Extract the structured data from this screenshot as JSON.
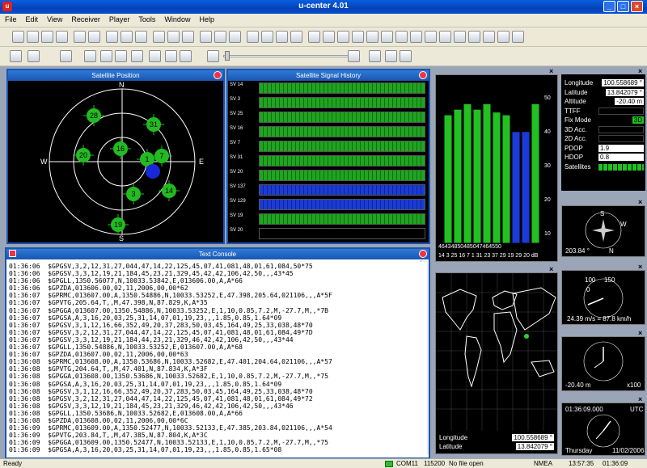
{
  "window": {
    "title": "u-center 4.01",
    "icon": "u",
    "min": "_",
    "max": "□",
    "close": "×"
  },
  "menu": [
    "File",
    "Edit",
    "View",
    "Receiver",
    "Player",
    "Tools",
    "Window",
    "Help"
  ],
  "panels": {
    "sat_position": "Satellite Position",
    "signal_history": "Satellite Signal History",
    "text_console": "Text Console"
  },
  "compass": {
    "n": "N",
    "s": "S",
    "e": "E",
    "w": "W"
  },
  "satellites": [
    "28",
    "31",
    "16",
    "1",
    "7",
    "20",
    "3",
    "14",
    "19"
  ],
  "signal_history_labels": [
    "SV 14",
    "SV 3",
    "SV 25",
    "SV 16",
    "SV 7",
    "SV 31",
    "SV 20",
    "SV 137",
    "SV 129",
    "SV 19",
    "SV 20"
  ],
  "bar_chart": {
    "values": [
      46,
      43,
      48,
      50,
      48,
      50,
      47,
      46,
      45,
      50
    ],
    "low_labels": [
      "14",
      "3",
      "25",
      "16",
      "7",
      "1",
      "31",
      "23",
      "37",
      "29",
      "19",
      "29",
      "20"
    ],
    "unit": "dB",
    "ticks": [
      "50",
      "40",
      "30",
      "20",
      "10"
    ]
  },
  "console_lines": [
    "01:36:06  $GPGSV,3,2,12,31,27,044,47,14,22,125,45,07,41,081,48,01,61,084,50*75",
    "01:36:06  $GPGSV,3,3,12,19,21,184,45,23,21,329,45,42,42,106,42,50,,,43*45",
    "01:36:06  $GPGLL,1350.56077,N,10033.53842,E,013606.00,A,A*66",
    "01:36:06  $GPZDA,013606.00,02,11,2006,00,00*62",
    "01:36:07  $GPRMC,013607.00,A,1350.54886,N,10033.53252,E,47.398,205.64,021106,,,A*5F",
    "01:36:07  $GPVTG,205.64,T,,M,47.398,N,87.829,K,A*35",
    "01:36:07  $GPGGA,013607.00,1350.54886,N,10033.53252,E,1,10,0.85,7.2,M,-27.7,M,,*7B",
    "01:36:07  $GPGSA,A,3,16,20,03,25,31,14,07,01,19,23,,,1.85,0.85,1.64*09",
    "01:36:07  $GPGSV,3,1,12,16,66,352,49,20,37,283,50,03,45,164,49,25,33,038,48*70",
    "01:36:07  $GPGSV,3,2,12,31,27,044,47,14,22,125,45,07,41,081,48,01,61,084,49*7D",
    "01:36:07  $GPGSV,3,3,12,19,21,184,44,23,21,329,46,42,42,106,42,50,,,43*44",
    "01:36:07  $GPGLL,1350.54886,N,10033.53252,E,013607.00,A,A*68",
    "01:36:07  $GPZDA,013607.00,02,11,2006,00,00*63",
    "01:36:08  $GPRMC,013608.00,A,1350.53686,N,10033.52682,E,47.401,204.64,021106,,,A*57",
    "01:36:08  $GPVTG,204.64,T,,M,47.401,N,87.834,K,A*3F",
    "01:36:08  $GPGGA,013608.00,1350.53686,N,10033.52682,E,1,10,0.85,7.2,M,-27.7,M,,*75",
    "01:36:08  $GPGSA,A,3,16,20,03,25,31,14,07,01,19,23,,,1.85,0.85,1.64*09",
    "01:36:08  $GPGSV,3,1,12,16,66,352,49,20,37,283,50,03,45,164,49,25,33,038,48*70",
    "01:36:08  $GPGSV,3,2,12,31,27,044,47,14,22,125,45,07,41,081,48,01,61,084,49*72",
    "01:36:08  $GPGSV,3,3,12,19,21,184,45,23,21,329,46,42,42,106,42,50,,,43*46",
    "01:36:08  $GPGLL,1350.53686,N,10033.52682,E,013608.00,A,A*66",
    "01:36:08  $GPZDA,013608.00,02,11,2006,00,00*6C",
    "01:36:09  $GPRMC,013609.00,A,1350.52477,N,10033.52133,E,47.385,203.84,021106,,,A*54",
    "01:36:09  $GPVTG,203.84,T,,M,47.385,N,87.804,K,A*3C",
    "01:36:09  $GPGGA,013609.00,1350.52477,N,10033.52133,E,1,10,0.85,7.2,M,-27.7,M,,*75",
    "01:36:09  $GPGSA,A,3,16,20,03,25,31,14,07,01,19,23,,,1.85,0.85,1.65*08"
  ],
  "nav_info": {
    "Longitude": "100.558689 °",
    "Latitude": "13.842079 °",
    "Altitude": "-20.40 m",
    "TTFF": "",
    "Fix Mode": "3D",
    "3D Acc.": "",
    "2D Acc.": "",
    "PDOP": "1.9",
    "HDOP": "0.8",
    "Satellites": ""
  },
  "map": {
    "lon_label": "Longitude",
    "lat_label": "Latitude",
    "lon": "100.558689 °",
    "lat": "13.842079 °"
  },
  "compass_gauge": {
    "n": "N",
    "s": "S",
    "w": "W",
    "heading": "203.84 °"
  },
  "speed_gauge": {
    "t0": "0",
    "t150": "150",
    "t100": "100",
    "readout": "24.39 m/s = 87.8 km/h"
  },
  "alt_gauge": {
    "value": "-20.40 m",
    "mult": "x100"
  },
  "clock": {
    "time": "01:36:09.000",
    "tz": "UTC",
    "day": "Thursday",
    "date": "11/02/2006"
  },
  "statusbar": {
    "ready": "Ready",
    "port": "COM11",
    "baud": "115200",
    "file": "No file open",
    "protocol": "NMEA",
    "time1": "13:57:35",
    "time2": "01:36:09"
  }
}
